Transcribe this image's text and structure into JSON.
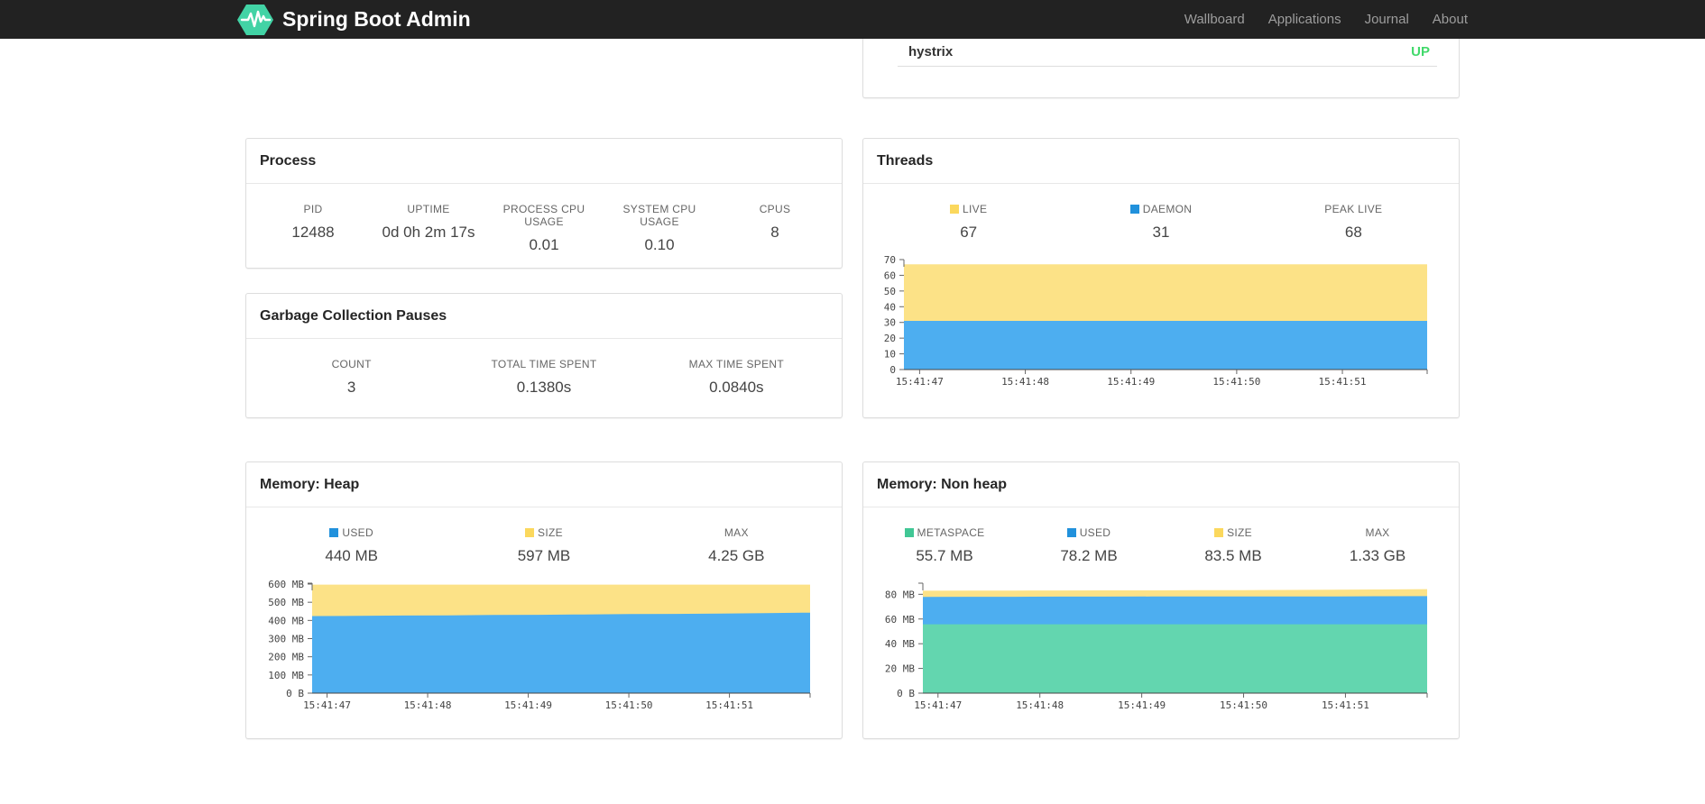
{
  "nav": {
    "brand": "Spring Boot Admin",
    "items": [
      {
        "label": "Wallboard"
      },
      {
        "label": "Applications"
      },
      {
        "label": "Journal"
      },
      {
        "label": "About"
      }
    ]
  },
  "colors": {
    "brand_green": "#42d3a5",
    "status_up": "#42d96b",
    "legend_yellow": "#fbd85d",
    "legend_blue": "#2191dc",
    "legend_green": "#41c795",
    "area_yellow": "#fce287",
    "area_blue": "#4daef0",
    "area_green": "#63d6af",
    "navbar_bg": "#222222"
  },
  "health": {
    "name": "hystrix",
    "status": "UP"
  },
  "process": {
    "title": "Process",
    "stats": [
      {
        "label": "PID",
        "value": "12488"
      },
      {
        "label": "UPTIME",
        "value": "0d 0h 2m 17s"
      },
      {
        "label": "PROCESS CPU USAGE",
        "value": "0.01"
      },
      {
        "label": "SYSTEM CPU USAGE",
        "value": "0.10"
      },
      {
        "label": "CPUS",
        "value": "8"
      }
    ]
  },
  "gc": {
    "title": "Garbage Collection Pauses",
    "stats": [
      {
        "label": "COUNT",
        "value": "3"
      },
      {
        "label": "TOTAL TIME SPENT",
        "value": "0.1380s"
      },
      {
        "label": "MAX TIME SPENT",
        "value": "0.0840s"
      }
    ]
  },
  "threads": {
    "title": "Threads",
    "stats": [
      {
        "label": "LIVE",
        "value": "67",
        "swatch": "#fbd85d"
      },
      {
        "label": "DAEMON",
        "value": "31",
        "swatch": "#2191dc"
      },
      {
        "label": "PEAK LIVE",
        "value": "68",
        "swatch": ""
      }
    ]
  },
  "heap": {
    "title": "Memory: Heap",
    "stats": [
      {
        "label": "USED",
        "value": "440 MB",
        "swatch": "#2191dc"
      },
      {
        "label": "SIZE",
        "value": "597 MB",
        "swatch": "#fbd85d"
      },
      {
        "label": "MAX",
        "value": "4.25 GB",
        "swatch": ""
      }
    ]
  },
  "nonheap": {
    "title": "Memory: Non heap",
    "stats": [
      {
        "label": "METASPACE",
        "value": "55.7 MB",
        "swatch": "#41c795"
      },
      {
        "label": "USED",
        "value": "78.2 MB",
        "swatch": "#2191dc"
      },
      {
        "label": "SIZE",
        "value": "83.5 MB",
        "swatch": "#fbd85d"
      },
      {
        "label": "MAX",
        "value": "1.33 GB",
        "swatch": ""
      }
    ]
  },
  "chart_data": [
    {
      "id": "threads",
      "type": "area",
      "title": "Threads",
      "ymax": 70,
      "y_tick_values": [
        0,
        10,
        20,
        30,
        40,
        50,
        60,
        70
      ],
      "y_tick_labels": [
        "0",
        "10",
        "20",
        "30",
        "40",
        "50",
        "60",
        "70"
      ],
      "x_tick_labels": [
        "15:41:47",
        "15:41:48",
        "15:41:49",
        "15:41:50",
        "15:41:51"
      ],
      "legend_position": "top",
      "grid": false,
      "series": [
        {
          "name": "LIVE",
          "fill": "#fce287",
          "values": [
            67,
            67,
            67,
            67,
            67,
            67,
            67,
            67,
            67,
            67,
            67,
            67
          ]
        },
        {
          "name": "DAEMON",
          "fill": "#4daef0",
          "values": [
            31,
            31,
            31,
            31,
            31,
            31,
            31,
            31,
            31,
            31,
            31,
            31
          ]
        }
      ]
    },
    {
      "id": "heap",
      "type": "area",
      "title": "Memory: Heap",
      "ymax": 605,
      "y_tick_values": [
        0,
        100,
        200,
        300,
        400,
        500,
        600
      ],
      "y_tick_labels": [
        "0 B",
        "100 MB",
        "200 MB",
        "300 MB",
        "400 MB",
        "500 MB",
        "600 MB"
      ],
      "x_tick_labels": [
        "15:41:47",
        "15:41:48",
        "15:41:49",
        "15:41:50",
        "15:41:51"
      ],
      "legend_position": "top",
      "grid": false,
      "series": [
        {
          "name": "SIZE",
          "fill": "#fce287",
          "values": [
            597,
            597,
            597,
            597,
            597,
            597,
            597,
            597,
            597,
            597,
            597,
            597
          ]
        },
        {
          "name": "USED",
          "fill": "#4daef0",
          "values": [
            424,
            425,
            427,
            428,
            430,
            431,
            433,
            435,
            436,
            438,
            440,
            443
          ]
        }
      ]
    },
    {
      "id": "nonheap",
      "type": "area",
      "title": "Memory: Non heap",
      "ymax": 89,
      "y_tick_values": [
        0,
        20,
        40,
        60,
        80
      ],
      "y_tick_labels": [
        "0 B",
        "20 MB",
        "40 MB",
        "60 MB",
        "80 MB"
      ],
      "x_tick_labels": [
        "15:41:47",
        "15:41:48",
        "15:41:49",
        "15:41:50",
        "15:41:51"
      ],
      "legend_position": "top",
      "grid": false,
      "series": [
        {
          "name": "SIZE",
          "fill": "#fce287",
          "values": [
            82.9,
            83.0,
            83.0,
            83.1,
            83.2,
            83.2,
            83.3,
            83.4,
            83.5,
            83.7,
            83.9,
            84.2
          ]
        },
        {
          "name": "USED",
          "fill": "#4daef0",
          "values": [
            77.9,
            78.0,
            78.0,
            78.1,
            78.1,
            78.2,
            78.2,
            78.3,
            78.3,
            78.3,
            78.4,
            78.5
          ]
        },
        {
          "name": "METASPACE",
          "fill": "#63d6af",
          "values": [
            55.7,
            55.7,
            55.7,
            55.7,
            55.7,
            55.7,
            55.7,
            55.7,
            55.7,
            55.7,
            55.7,
            55.7
          ]
        }
      ]
    }
  ]
}
